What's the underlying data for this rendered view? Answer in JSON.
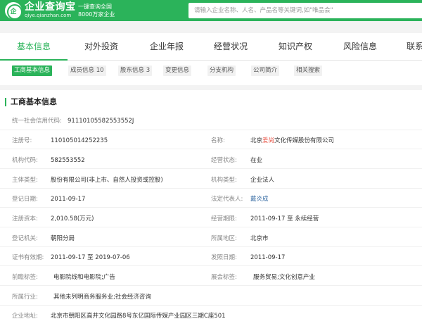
{
  "header": {
    "logo_text": "企",
    "brand_name": "企业查询宝",
    "brand_url": "qiye.qianzhan.com",
    "slogan_line1": "一键查询全国",
    "slogan_line2": "8000万家企业",
    "search_placeholder": "请输入企业名称、人名、产品名等关键词,如\"唯品会\""
  },
  "tabs": [
    "基本信息",
    "对外投资",
    "企业年报",
    "经营状况",
    "知识产权",
    "风险信息",
    "联系"
  ],
  "subtabs": [
    "工商基本信息",
    "成员信息 10",
    "股东信息 3",
    "变更信息",
    "分支机构",
    "公司简介",
    "相关搜索"
  ],
  "card": {
    "title": "工商基本信息",
    "credit_code": {
      "label": "统一社会信用代码:",
      "value": "91110105582553552J"
    },
    "reg_no": {
      "label": "注册号:",
      "value": "110105014252235"
    },
    "company_name": {
      "label": "名称:",
      "pre": "北京",
      "highlight": "爱尚",
      "post": "文化传媒股份有限公司"
    },
    "org_code": {
      "label": "机构代码:",
      "value": "582553552"
    },
    "status": {
      "label": "经营状态:",
      "value": "在业"
    },
    "company_type": {
      "label": "主体类型:",
      "value": "股份有限公司(非上市、自然人投资或控股)"
    },
    "org_type": {
      "label": "机构类型:",
      "value": "企业法人"
    },
    "reg_date": {
      "label": "登记日期:",
      "value": "2011-09-17"
    },
    "legal_rep": {
      "label": "法定代表人:",
      "value": "戴炎成"
    },
    "capital": {
      "label": "注册资本:",
      "value": "2,010.58(万元)"
    },
    "term": {
      "label": "经营期限:",
      "value": "2011-09-17 至 永续经营"
    },
    "authority": {
      "label": "登记机关:",
      "value": "朝阳分局"
    },
    "region": {
      "label": "所属地区:",
      "value": "北京市"
    },
    "cert_validity": {
      "label": "证书有效期:",
      "value": "2011-09-17 至 2019-07-06"
    },
    "issue_date": {
      "label": "发照日期:",
      "value": "2011-09-17"
    },
    "front_tags": {
      "label": "前瞻标签:",
      "value": "电影院线和电影院;广告"
    },
    "exhibit_tags": {
      "label": "展会标签:",
      "value": "服务贸易;文化创意产业"
    },
    "industry": {
      "label": "所属行业:",
      "value": "其他未列明商务服务业;社会经济咨询"
    },
    "address": {
      "label": "企业地址:",
      "value": "北京市朝阳区高井文化园路8号东亿国际传媒产业园区三期C座501"
    }
  },
  "colors": {
    "accent": "#2bb35a",
    "link": "#3a6ea5",
    "highlight": "#e64b3c"
  }
}
